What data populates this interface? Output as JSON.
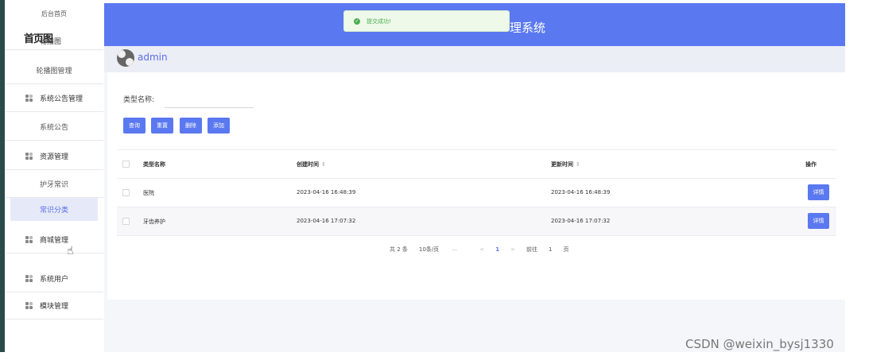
{
  "header": {
    "title_partial": "理系统"
  },
  "toast": {
    "message": "提交成功!"
  },
  "sidebar": {
    "home": "后台首页",
    "overlap_text": "首页图",
    "lunbo_group": "轮播图",
    "items": [
      {
        "label": "轮播图管理",
        "kind": "sub"
      },
      {
        "label": "系统公告管理",
        "kind": "group"
      },
      {
        "label": "系统公告",
        "kind": "sub"
      },
      {
        "label": "资源管理",
        "kind": "group"
      },
      {
        "label": "护牙常识",
        "kind": "sub"
      },
      {
        "label": "常识分类",
        "kind": "sub",
        "active": true
      },
      {
        "label": "商城管理",
        "kind": "group"
      },
      {
        "label": "系统用户",
        "kind": "group"
      },
      {
        "label": "模块管理",
        "kind": "group"
      }
    ]
  },
  "user": {
    "name": "admin"
  },
  "search": {
    "label": "类型名称:",
    "value": ""
  },
  "buttons": {
    "query": "查询",
    "reset": "重置",
    "delete": "删除",
    "add": "添加"
  },
  "table": {
    "headers": {
      "name": "类型名称",
      "create": "创建时间",
      "update": "更新时间",
      "op": "操作",
      "sort_icon": "⇕"
    },
    "rows": [
      {
        "name": "医院",
        "create": "2023-04-16 16:48:39",
        "update": "2023-04-16 16:48:39",
        "action": "详情"
      },
      {
        "name": "牙齿养护",
        "create": "2023-04-16 17:07:32",
        "update": "2023-04-16 17:07:32",
        "action": "详情"
      }
    ]
  },
  "pagination": {
    "total": "共 2 条",
    "page_size": "10条/页",
    "prev": "<",
    "next": ">",
    "current": "1",
    "goto": "前往",
    "goto_value": "1",
    "page_unit": "页",
    "dash": "—"
  },
  "watermark": "CSDN @weixin_bysj1330",
  "colors": {
    "accent": "#5a78f0",
    "success": "#4caf50"
  }
}
